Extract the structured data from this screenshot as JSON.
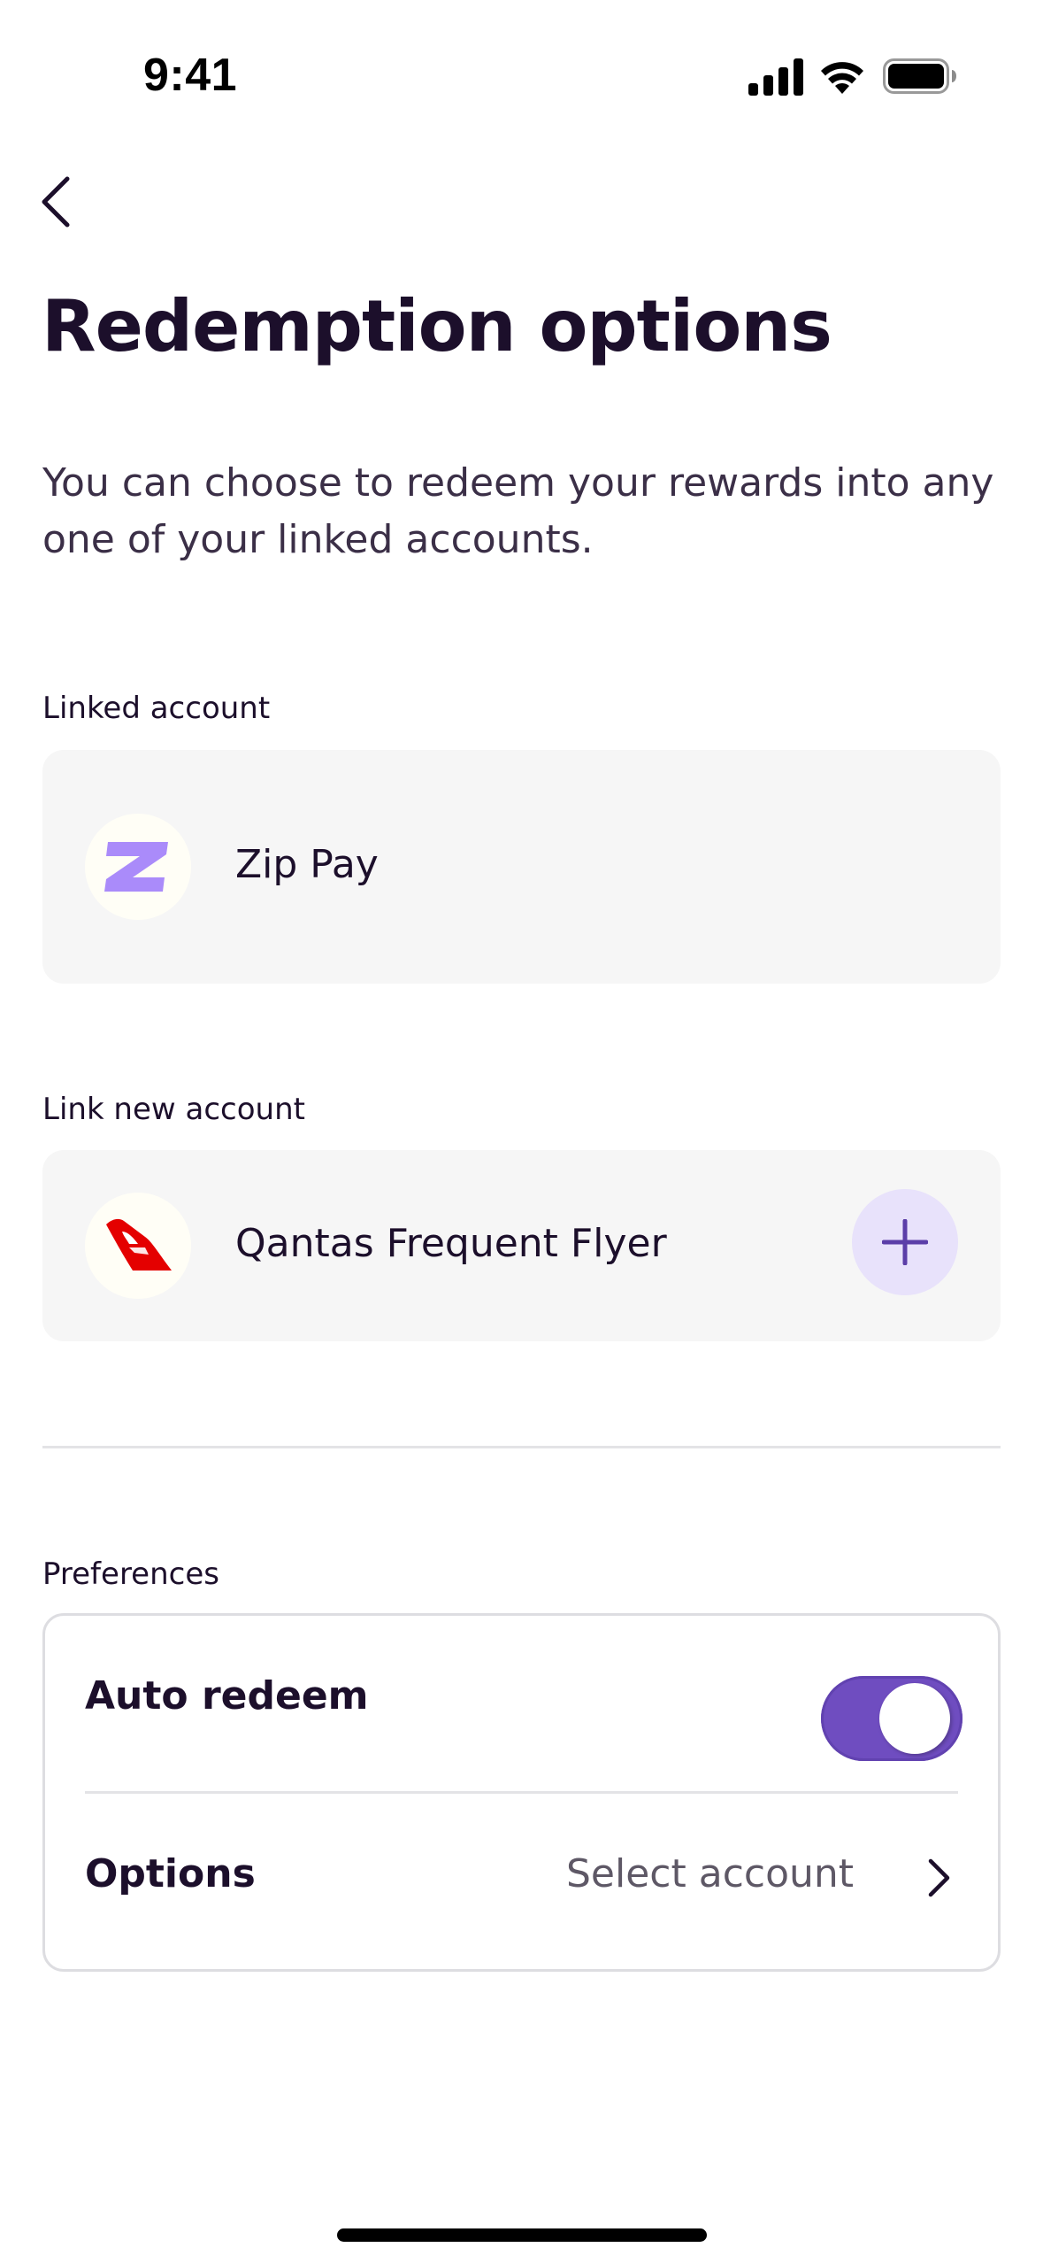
{
  "status_bar": {
    "time": "9:41"
  },
  "nav": {
    "back_icon": "chevron-left-icon"
  },
  "page": {
    "title": "Redemption options",
    "intro": "You can choose to redeem your rewards into any one of your linked accounts."
  },
  "linked": {
    "label": "Linked account",
    "account": {
      "name": "Zip Pay",
      "icon": "zip-logo-icon",
      "brand_color": "#aa8bfa"
    }
  },
  "link_new": {
    "label": "Link new account",
    "account": {
      "name": "Qantas Frequent Flyer",
      "icon": "qantas-logo-icon",
      "brand_color": "#e40000"
    },
    "add_icon": "plus-icon"
  },
  "preferences": {
    "label": "Preferences",
    "auto_redeem": {
      "label": "Auto redeem",
      "enabled": true
    },
    "options": {
      "label": "Options",
      "value": "Select account",
      "icon": "chevron-right-icon"
    }
  },
  "colors": {
    "accent": "#6f4dc0",
    "text_primary": "#1c0f2b",
    "card_bg": "#f6f6f6"
  }
}
